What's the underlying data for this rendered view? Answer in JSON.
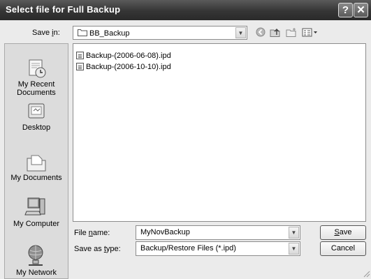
{
  "window": {
    "title": "Select file for Full Backup",
    "help_label": "?",
    "close_label": "✕"
  },
  "toolbar": {
    "save_in_label": "Save in:",
    "current_folder": "BB_Backup",
    "back_icon": "back-arrow-icon",
    "up_icon": "up-folder-icon",
    "new_folder_icon": "new-folder-icon",
    "views_icon": "views-menu-icon"
  },
  "places": [
    {
      "label": "My Recent Documents",
      "icon": "recent-documents-icon"
    },
    {
      "label": "Desktop",
      "icon": "desktop-icon"
    },
    {
      "label": "My Documents",
      "icon": "my-documents-icon"
    },
    {
      "label": "My Computer",
      "icon": "my-computer-icon"
    },
    {
      "label": "My Network",
      "icon": "my-network-icon"
    }
  ],
  "files": [
    "Backup-(2006-06-08).ipd",
    "Backup-(2006-10-10).ipd"
  ],
  "form": {
    "file_name_label": "File name:",
    "file_name_value": "MyNovBackup",
    "save_type_label": "Save as type:",
    "save_type_value": "Backup/Restore Files (*.ipd)"
  },
  "buttons": {
    "save": "Save",
    "cancel": "Cancel"
  }
}
